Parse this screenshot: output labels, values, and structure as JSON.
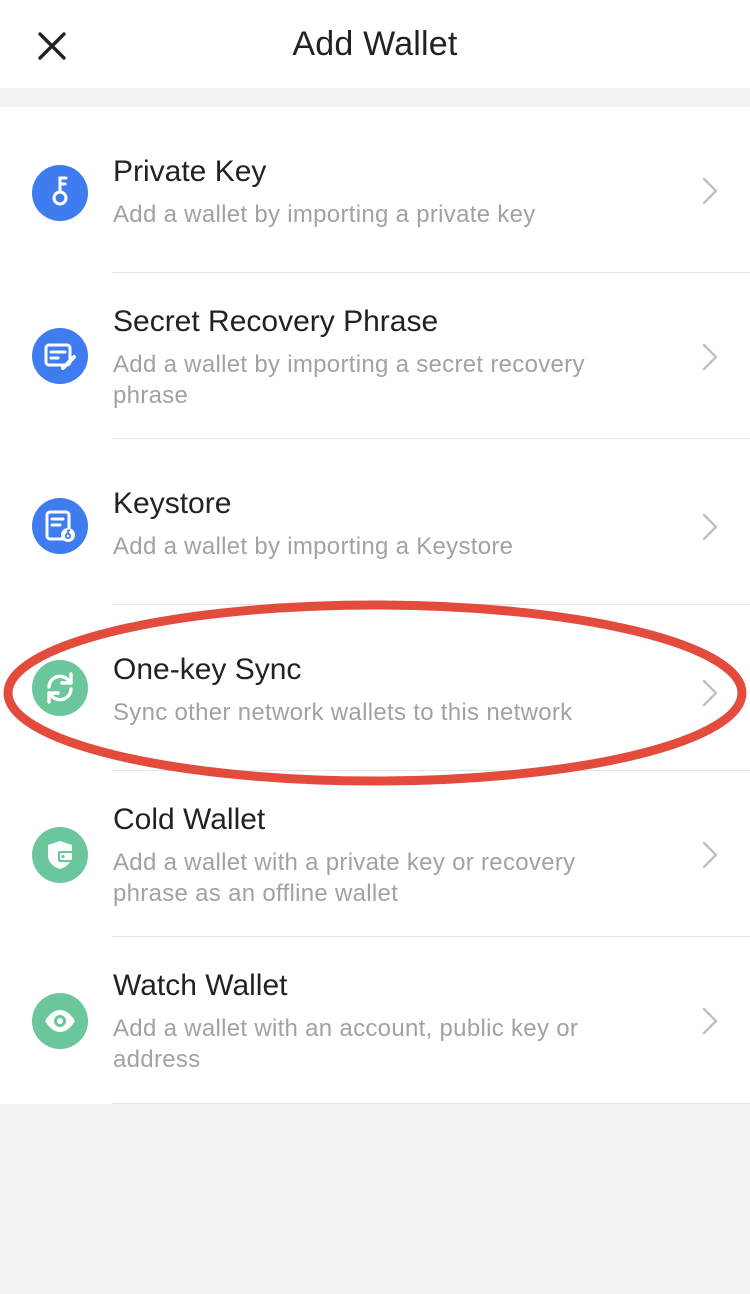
{
  "header": {
    "title": "Add Wallet",
    "close_icon": "close-icon"
  },
  "colors": {
    "blue_icon_bg": "#3e7cf0",
    "green_icon_bg": "#6cc69b",
    "highlight_ellipse": "#e34b3c"
  },
  "items": [
    {
      "label": "Private Key",
      "desc": "Add a wallet by importing a private key",
      "icon": "key-icon"
    },
    {
      "label": "Secret Recovery Phrase",
      "desc": "Add a wallet by importing a secret recovery phrase",
      "icon": "document-edit-icon"
    },
    {
      "label": "Keystore",
      "desc": "Add a wallet by importing a Keystore",
      "icon": "keystore-file-icon"
    },
    {
      "label": "One-key Sync",
      "desc": "Sync other network wallets to this network",
      "icon": "sync-icon"
    },
    {
      "label": "Cold Wallet",
      "desc": "Add a wallet with a private key or recovery phrase as an offline wallet",
      "icon": "shield-wallet-icon"
    },
    {
      "label": "Watch Wallet",
      "desc": "Add a wallet with an account, public key or address",
      "icon": "eye-icon"
    }
  ]
}
